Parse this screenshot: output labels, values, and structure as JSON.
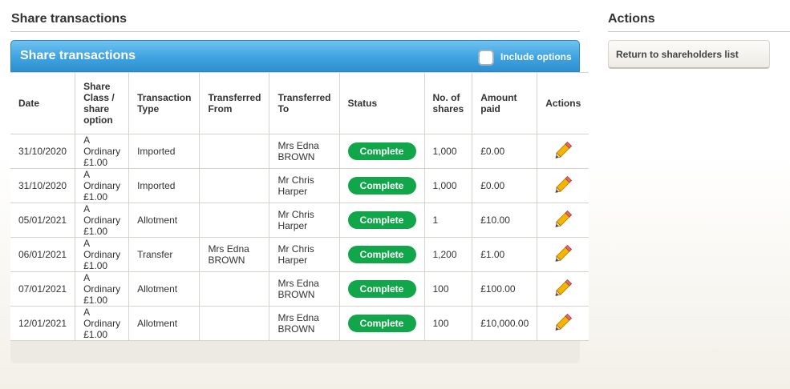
{
  "main": {
    "heading": "Share transactions",
    "panel_title": "Share transactions",
    "include_options_label": "Include options",
    "columns": [
      "Date",
      "Share Class / share option",
      "Transaction Type",
      "Transferred From",
      "Transferred To",
      "Status",
      "No. of shares",
      "Amount paid",
      "Actions"
    ],
    "rows": [
      {
        "date": "31/10/2020",
        "share_class": "A Ordinary £1.00",
        "type": "Imported",
        "from": "",
        "to": "Mrs Edna BROWN",
        "status": "Complete",
        "shares": "1,000",
        "amount": "£0.00"
      },
      {
        "date": "31/10/2020",
        "share_class": "A Ordinary £1.00",
        "type": "Imported",
        "from": "",
        "to": "Mr Chris Harper",
        "status": "Complete",
        "shares": "1,000",
        "amount": "£0.00"
      },
      {
        "date": "05/01/2021",
        "share_class": "A Ordinary £1.00",
        "type": "Allotment",
        "from": "",
        "to": "Mr Chris Harper",
        "status": "Complete",
        "shares": "1",
        "amount": "£10.00"
      },
      {
        "date": "06/01/2021",
        "share_class": "A Ordinary £1.00",
        "type": "Transfer",
        "from": "Mrs Edna BROWN",
        "to": "Mr Chris Harper",
        "status": "Complete",
        "shares": "1,200",
        "amount": "£1.00"
      },
      {
        "date": "07/01/2021",
        "share_class": "A Ordinary £1.00",
        "type": "Allotment",
        "from": "",
        "to": "Mrs Edna BROWN",
        "status": "Complete",
        "shares": "100",
        "amount": "£100.00"
      },
      {
        "date": "12/01/2021",
        "share_class": "A Ordinary £1.00",
        "type": "Allotment",
        "from": "",
        "to": "Mrs Edna BROWN",
        "status": "Complete",
        "shares": "100",
        "amount": "£10,000.00"
      }
    ]
  },
  "actions": {
    "heading": "Actions",
    "return_label": "Return to shareholders list"
  },
  "icons": {
    "edit": "pencil-icon",
    "checkbox": "checkbox-icon"
  },
  "colors": {
    "header_blue": "#3ea3e0",
    "status_green": "#12a64a"
  }
}
